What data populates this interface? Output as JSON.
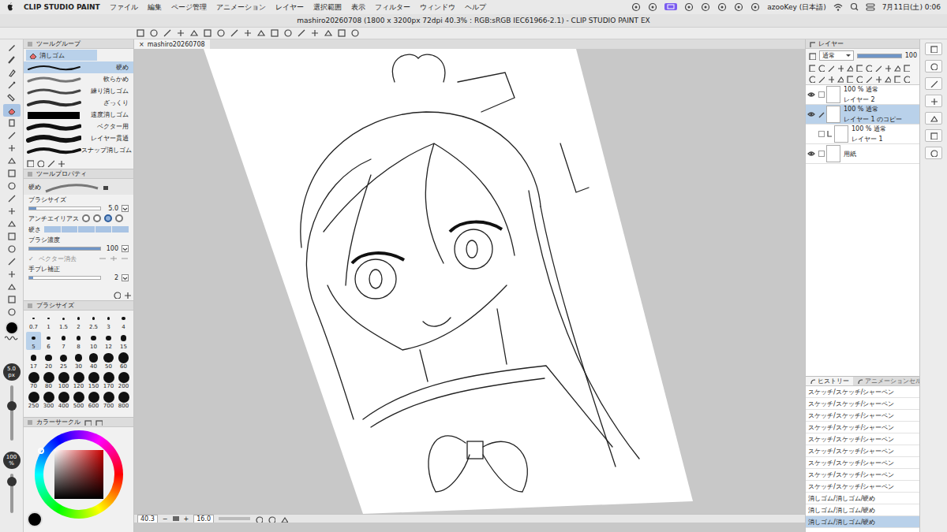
{
  "menubar": {
    "app": "CLIP STUDIO PAINT",
    "menus": [
      "ファイル",
      "編集",
      "ページ管理",
      "アニメーション",
      "レイヤー",
      "選択範囲",
      "表示",
      "フィルター",
      "ウィンドウ",
      "ヘルプ"
    ],
    "input_source": "azooKey (日本語)",
    "clock": "7月11日(土) 0:06"
  },
  "window": {
    "title": "mashiro20260708 (1800 x 3200px 72dpi 40.3% : RGB:sRGB IEC61966-2.1)  - CLIP STUDIO PAINT EX"
  },
  "canvas_tab": {
    "label": "mashiro20260708",
    "close": "×"
  },
  "tool_bar": {
    "tools": [
      {
        "selected": false
      },
      {
        "selected": false
      },
      {
        "selected": false
      },
      {
        "selected": false
      },
      {
        "selected": false
      },
      {
        "selected": true
      },
      {
        "selected": false
      },
      {
        "selected": false
      },
      {
        "selected": false
      },
      {
        "selected": false
      },
      {
        "selected": false
      },
      {
        "selected": false
      },
      {
        "selected": false
      },
      {
        "selected": false
      },
      {
        "selected": false
      },
      {
        "selected": false
      },
      {
        "selected": false
      },
      {
        "selected": false
      },
      {
        "selected": false
      },
      {
        "selected": false
      },
      {
        "selected": false
      },
      {
        "selected": false
      }
    ]
  },
  "tool_group": {
    "title": "ツールグループ",
    "tab": "消しゴム",
    "subtools": [
      {
        "label": "硬め",
        "selected": true
      },
      {
        "label": "軟らかめ",
        "selected": false
      },
      {
        "label": "練り消しゴム",
        "selected": false
      },
      {
        "label": "ざっくり",
        "selected": false
      },
      {
        "label": "速度消しゴム",
        "selected": false
      },
      {
        "label": "ベクター用",
        "selected": false
      },
      {
        "label": "レイヤー貫通",
        "selected": false
      },
      {
        "label": "スナップ消しゴム",
        "selected": false
      }
    ]
  },
  "tool_property": {
    "title": "ツールプロパティ",
    "preset": "硬め",
    "brush_size": {
      "label": "ブラシサイズ",
      "value": "5.0",
      "level": 0.1
    },
    "antialias": {
      "label": "アンチエイリアス",
      "options": [
        {
          "selected": false
        },
        {
          "selected": false
        },
        {
          "selected": true
        },
        {
          "selected": false
        }
      ]
    },
    "hardness": {
      "label": "硬さ",
      "level": 1
    },
    "density": {
      "label": "ブラシ濃度",
      "value": "100",
      "level": 1
    },
    "vector_erase": {
      "check": "✓",
      "label": "ベクター消去",
      "checked": true,
      "disabled": true
    },
    "stabilization": {
      "label": "手ブレ補正",
      "value": "2",
      "level": 0.05
    }
  },
  "brush_size_palette": {
    "title": "ブラシサイズ",
    "sizes": [
      {
        "label": "0.7",
        "selected": false
      },
      {
        "label": "1",
        "selected": false
      },
      {
        "label": "1.5",
        "selected": false
      },
      {
        "label": "2",
        "selected": false
      },
      {
        "label": "2.5",
        "selected": false
      },
      {
        "label": "3",
        "selected": false
      },
      {
        "label": "4",
        "selected": false
      },
      {
        "label": "5",
        "selected": true
      },
      {
        "label": "6",
        "selected": false
      },
      {
        "label": "7",
        "selected": false
      },
      {
        "label": "8",
        "selected": false
      },
      {
        "label": "10",
        "selected": false
      },
      {
        "label": "12",
        "selected": false
      },
      {
        "label": "15",
        "selected": false
      },
      {
        "label": "17",
        "selected": false
      },
      {
        "label": "20",
        "selected": false
      },
      {
        "label": "25",
        "selected": false
      },
      {
        "label": "30",
        "selected": false
      },
      {
        "label": "40",
        "selected": false
      },
      {
        "label": "50",
        "selected": false
      },
      {
        "label": "60",
        "selected": false
      },
      {
        "label": "70",
        "selected": false
      },
      {
        "label": "80",
        "selected": false
      },
      {
        "label": "100",
        "selected": false
      },
      {
        "label": "120",
        "selected": false
      },
      {
        "label": "150",
        "selected": false
      },
      {
        "label": "170",
        "selected": false
      },
      {
        "label": "200",
        "selected": false
      },
      {
        "label": "250",
        "selected": false
      },
      {
        "label": "300",
        "selected": false
      },
      {
        "label": "400",
        "selected": false
      },
      {
        "label": "500",
        "selected": false
      },
      {
        "label": "600",
        "selected": false
      },
      {
        "label": "700",
        "selected": false
      },
      {
        "label": "800",
        "selected": false
      }
    ]
  },
  "color_circle": {
    "title": "カラーサークル"
  },
  "size_indicator": {
    "value": "5.0",
    "unit": "px",
    "level": 0.65
  },
  "opacity_indicator": {
    "value": "100",
    "unit": "%",
    "level": 0.1
  },
  "status_bar": {
    "zoom": "40.3",
    "minus": "−",
    "plus": "+",
    "angle": "16.0"
  },
  "layers": {
    "title": "レイヤー",
    "blend": "通常",
    "opacity": "100",
    "items": [
      {
        "info": "100 % 通常",
        "name": "レイヤー 2",
        "visible": true,
        "selected": false,
        "editing": false,
        "clipped": false
      },
      {
        "info": "100 % 通常",
        "name": "レイヤー 1 のコピー",
        "visible": true,
        "selected": true,
        "editing": true,
        "clipped": false
      },
      {
        "info": "100 % 通常",
        "name": "レイヤー 1",
        "visible": false,
        "selected": false,
        "editing": false,
        "clipped": true
      },
      {
        "info": "",
        "name": "用紙",
        "visible": true,
        "selected": false,
        "editing": false,
        "clipped": false
      }
    ]
  },
  "history": {
    "tabs": [
      {
        "label": "ヒストリー",
        "selected": true
      },
      {
        "label": "アニメーションセル",
        "selected": false
      }
    ],
    "items": [
      {
        "label": "スケッチ/スケッチ/シャーペン",
        "selected": false
      },
      {
        "label": "スケッチ/スケッチ/シャーペン",
        "selected": false
      },
      {
        "label": "スケッチ/スケッチ/シャーペン",
        "selected": false
      },
      {
        "label": "スケッチ/スケッチ/シャーペン",
        "selected": false
      },
      {
        "label": "スケッチ/スケッチ/シャーペン",
        "selected": false
      },
      {
        "label": "スケッチ/スケッチ/シャーペン",
        "selected": false
      },
      {
        "label": "スケッチ/スケッチ/シャーペン",
        "selected": false
      },
      {
        "label": "スケッチ/スケッチ/シャーペン",
        "selected": false
      },
      {
        "label": "スケッチ/スケッチ/シャーペン",
        "selected": false
      },
      {
        "label": "消しゴム/消しゴム/硬め",
        "selected": false
      },
      {
        "label": "消しゴム/消しゴム/硬め",
        "selected": false
      },
      {
        "label": "消しゴム/消しゴム/硬め",
        "selected": true
      }
    ]
  }
}
